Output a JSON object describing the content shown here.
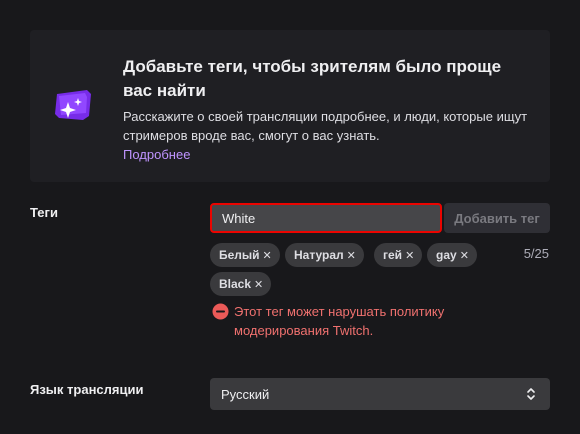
{
  "promo": {
    "title": "Добавьте теги, чтобы зрителям было проще вас найти",
    "description": "Расскажите о своей трансляции подробнее, и люди, которые ищут стримеров вроде вас, смогут о вас узнать.",
    "link": "Подробнее",
    "icon": "sparkle-tag-icon"
  },
  "tags": {
    "label": "Теги",
    "input_value": "White",
    "add_button": "Добавить тег",
    "count": "5/25",
    "items": [
      {
        "label": "Белый"
      },
      {
        "label": "Натурал"
      },
      {
        "label": "гей"
      },
      {
        "label": "gay"
      },
      {
        "label": "Black"
      }
    ],
    "warning": "Этот тег может нарушать политику модерирования Twitch."
  },
  "language": {
    "label": "Язык трансляции",
    "selected": "Русский"
  },
  "colors": {
    "background": "#18181b",
    "card": "#1f1f23",
    "accent": "#bf94ff",
    "error": "#eb0400",
    "chip": "#3a3a3d"
  }
}
